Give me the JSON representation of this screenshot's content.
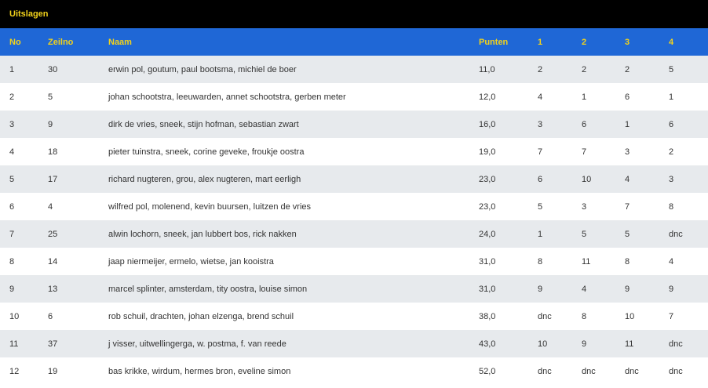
{
  "title": "Uitslagen",
  "columns": [
    "No",
    "Zeilno",
    "Naam",
    "Punten",
    "1",
    "2",
    "3",
    "4"
  ],
  "rows": [
    [
      "1",
      "30",
      "erwin pol, goutum, paul bootsma, michiel de boer",
      "11,0",
      "2",
      "2",
      "2",
      "5"
    ],
    [
      "2",
      "5",
      "johan schootstra, leeuwarden, annet schootstra, gerben meter",
      "12,0",
      "4",
      "1",
      "6",
      "1"
    ],
    [
      "3",
      "9",
      "dirk de vries, sneek, stijn hofman, sebastian zwart",
      "16,0",
      "3",
      "6",
      "1",
      "6"
    ],
    [
      "4",
      "18",
      "pieter tuinstra, sneek, corine geveke, froukje oostra",
      "19,0",
      "7",
      "7",
      "3",
      "2"
    ],
    [
      "5",
      "17",
      "richard nugteren, grou, alex nugteren, mart eerligh",
      "23,0",
      "6",
      "10",
      "4",
      "3"
    ],
    [
      "6",
      "4",
      "wilfred pol, molenend, kevin buursen, luitzen de vries",
      "23,0",
      "5",
      "3",
      "7",
      "8"
    ],
    [
      "7",
      "25",
      "alwin lochorn, sneek, jan lubbert bos, rick nakken",
      "24,0",
      "1",
      "5",
      "5",
      "dnc"
    ],
    [
      "8",
      "14",
      "jaap niermeijer, ermelo, wietse, jan kooistra",
      "31,0",
      "8",
      "11",
      "8",
      "4"
    ],
    [
      "9",
      "13",
      "marcel splinter, amsterdam, tity oostra, louise simon",
      "31,0",
      "9",
      "4",
      "9",
      "9"
    ],
    [
      "10",
      "6",
      "rob schuil, drachten, johan elzenga, brend schuil",
      "38,0",
      "dnc",
      "8",
      "10",
      "7"
    ],
    [
      "11",
      "37",
      "j visser, uitwellingerga, w. postma, f. van reede",
      "43,0",
      "10",
      "9",
      "11",
      "dnc"
    ],
    [
      "12",
      "19",
      "bas krikke, wirdum, hermes bron, eveline simon",
      "52,0",
      "dnc",
      "dnc",
      "dnc",
      "dnc"
    ]
  ],
  "colors": {
    "title_bar": "#000000",
    "header_bar": "#1f67d6",
    "header_text": "#f2d21b",
    "row_alt": "#e7eaed",
    "row": "#ffffff"
  }
}
